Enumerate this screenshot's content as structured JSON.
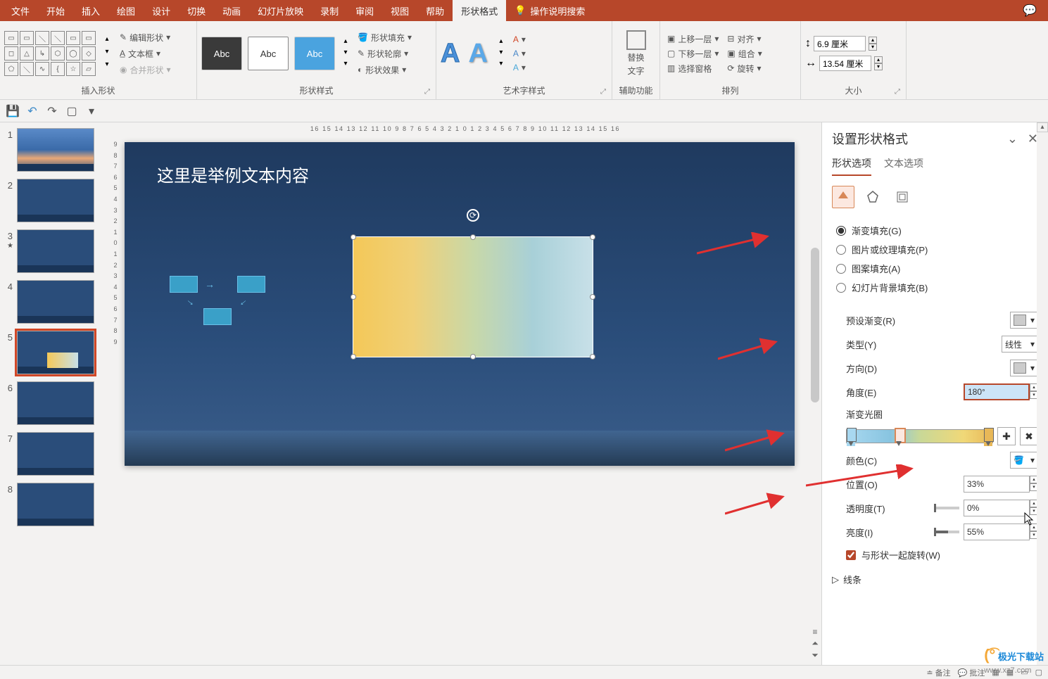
{
  "tabs": {
    "file": "文件",
    "home": "开始",
    "insert": "插入",
    "draw": "绘图",
    "design": "设计",
    "transitions": "切换",
    "animations": "动画",
    "slideshow": "幻灯片放映",
    "record": "录制",
    "review": "审阅",
    "view": "视图",
    "help": "帮助",
    "shape_format": "形状格式",
    "tell_me": "操作说明搜索"
  },
  "ribbon": {
    "groups": {
      "insert_shapes": "插入形状",
      "shape_styles": "形状样式",
      "wordart_styles": "艺术字样式",
      "accessibility": "辅助功能",
      "arrange": "排列",
      "size": "大小"
    },
    "shape_edit": {
      "edit_shape": "编辑形状",
      "text_box": "文本框",
      "merge_shapes": "合并形状"
    },
    "style_sample": "Abc",
    "shape_fill_label": "形状填充",
    "shape_outline_label": "形状轮廓",
    "shape_effects_label": "形状效果",
    "alt_text_l1": "替换",
    "alt_text_l2": "文字",
    "arrange": {
      "bring_forward": "上移一层",
      "send_backward": "下移一层",
      "selection_pane": "选择窗格",
      "align": "对齐",
      "group": "组合",
      "rotate": "旋转"
    },
    "size": {
      "height": "6.9 厘米",
      "width": "13.54 厘米"
    }
  },
  "slide": {
    "title": "这里是举例文本内容"
  },
  "ruler_h": "16 15 14 13 12 11 10 9 8 7 6 5 4 3 2 1 0 1 2 3 4 5 6 7 8 9 10 11 12 13 14 15 16",
  "ruler_v": [
    "9",
    "8",
    "7",
    "6",
    "5",
    "4",
    "3",
    "2",
    "1",
    "0",
    "1",
    "2",
    "3",
    "4",
    "5",
    "6",
    "7",
    "8",
    "9"
  ],
  "format_pane": {
    "title": "设置形状格式",
    "tab_shape": "形状选项",
    "tab_text": "文本选项",
    "fill": {
      "gradient_fill": "渐变填充(G)",
      "picture_fill": "图片或纹理填充(P)",
      "pattern_fill": "图案填充(A)",
      "slide_bg_fill": "幻灯片背景填充(B)",
      "preset_gradients": "预设渐变(R)",
      "type": "类型(Y)",
      "type_value": "线性",
      "direction": "方向(D)",
      "angle": "角度(E)",
      "angle_value": "180°",
      "gradient_stops": "渐变光圈",
      "color": "颜色(C)",
      "position": "位置(O)",
      "position_value": "33%",
      "transparency": "透明度(T)",
      "transparency_value": "0%",
      "brightness": "亮度(I)",
      "brightness_value": "55%",
      "rotate_with_shape": "与形状一起旋转(W)"
    },
    "line_section": "线条"
  },
  "status": {
    "agenda": "备注",
    "annotations": "批注"
  },
  "watermark": {
    "brand": "极光下载站",
    "url": "www.xz7.com"
  },
  "thumbs": [
    "1",
    "2",
    "3",
    "4",
    "5",
    "6",
    "7",
    "8"
  ]
}
